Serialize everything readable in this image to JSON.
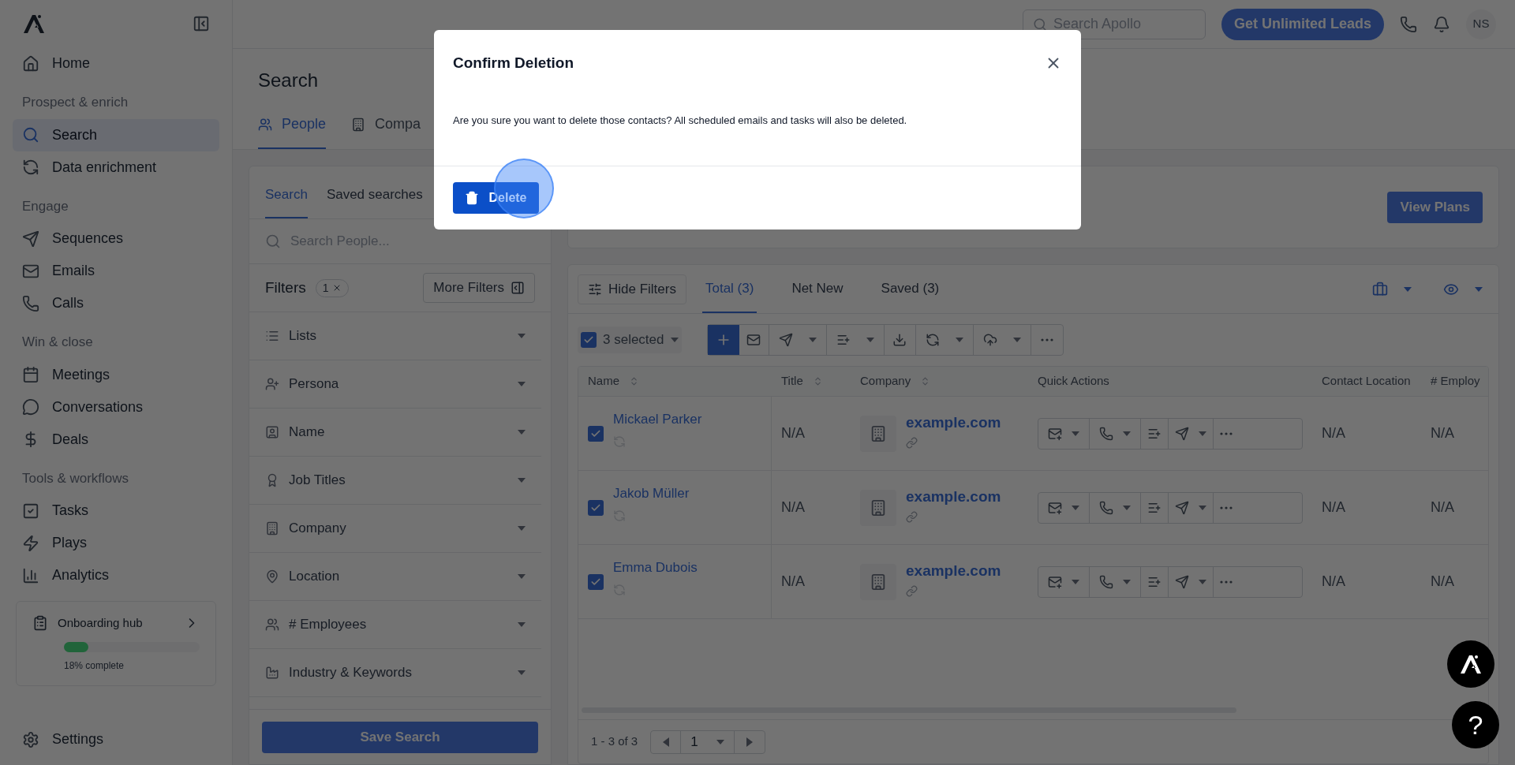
{
  "sidebar": {
    "groups": [
      {
        "items": [
          {
            "label": "Home",
            "selected": false
          }
        ]
      },
      {
        "heading": "Prospect & enrich",
        "items": [
          {
            "label": "Search",
            "selected": true
          },
          {
            "label": "Data enrichment",
            "selected": false
          }
        ]
      },
      {
        "heading": "Engage",
        "items": [
          {
            "label": "Sequences",
            "selected": false
          },
          {
            "label": "Emails",
            "selected": false
          },
          {
            "label": "Calls",
            "selected": false
          }
        ]
      },
      {
        "heading": "Win & close",
        "items": [
          {
            "label": "Meetings",
            "selected": false
          },
          {
            "label": "Conversations",
            "selected": false
          },
          {
            "label": "Deals",
            "selected": false
          }
        ]
      },
      {
        "heading": "Tools & workflows",
        "items": [
          {
            "label": "Tasks",
            "selected": false
          },
          {
            "label": "Plays",
            "selected": false
          },
          {
            "label": "Analytics",
            "selected": false
          }
        ]
      }
    ],
    "onboarding": {
      "title": "Onboarding hub",
      "level": 0.18,
      "reading": "18% complete"
    },
    "settings": {
      "label": "Settings"
    }
  },
  "topbar": {
    "search": {
      "placeholder": "Search Apollo"
    },
    "cta": "Get Unlimited Leads",
    "avatar": "NS"
  },
  "search_page": {
    "title": "Search",
    "tabs": [
      {
        "label": "People",
        "selected": true
      },
      {
        "label": "Compa",
        "selected": false
      }
    ]
  },
  "filter_panel": {
    "tabs": [
      {
        "label": "Search",
        "selected": true
      },
      {
        "label": "Saved searches",
        "selected": false
      }
    ],
    "search": {
      "placeholder": "Search People..."
    },
    "filters_label": "Filters",
    "filter_count": "1",
    "more_filters": "More Filters",
    "filters": [
      {
        "label": "Lists"
      },
      {
        "label": "Persona"
      },
      {
        "label": "Name"
      },
      {
        "label": "Job Titles"
      },
      {
        "label": "Company"
      },
      {
        "label": "Location"
      },
      {
        "label": "# Employees"
      },
      {
        "label": "Industry & Keywords"
      }
    ],
    "save_button": "Save Search"
  },
  "banner": {
    "button": "View Plans"
  },
  "results": {
    "hide_filters": "Hide Filters",
    "tabs": [
      {
        "label": "Total (3)",
        "selected": true
      },
      {
        "label": "Net New",
        "selected": false
      },
      {
        "label": "Saved (3)",
        "selected": false
      }
    ],
    "selection": {
      "label": "3 selected",
      "checked": true
    },
    "table": {
      "columns": [
        {
          "label": "Name",
          "sortable": true
        },
        {
          "label": "Title",
          "sortable": true
        },
        {
          "label": "Company",
          "sortable": true
        },
        {
          "label": "Quick Actions"
        },
        {
          "label": "Contact Location"
        },
        {
          "label": "# Employ"
        }
      ],
      "rows": [
        {
          "name": "Mickael Parker",
          "checked": true,
          "title": "N/A",
          "company": "example.com",
          "location": "N/A",
          "employees": "N/A"
        },
        {
          "name": "Jakob Müller",
          "checked": true,
          "title": "N/A",
          "company": "example.com",
          "location": "N/A",
          "employees": "N/A"
        },
        {
          "name": "Emma Dubois",
          "checked": true,
          "title": "N/A",
          "company": "example.com",
          "location": "N/A",
          "employees": "N/A"
        }
      ]
    },
    "pagination": {
      "range": "1 - 3 of 3",
      "page": "1"
    }
  },
  "help_button": "?",
  "modal": {
    "title": "Confirm Deletion",
    "message": "Are you sure you want to delete those contacts? All scheduled emails and tasks will also be deleted.",
    "delete_button": "Delete"
  }
}
